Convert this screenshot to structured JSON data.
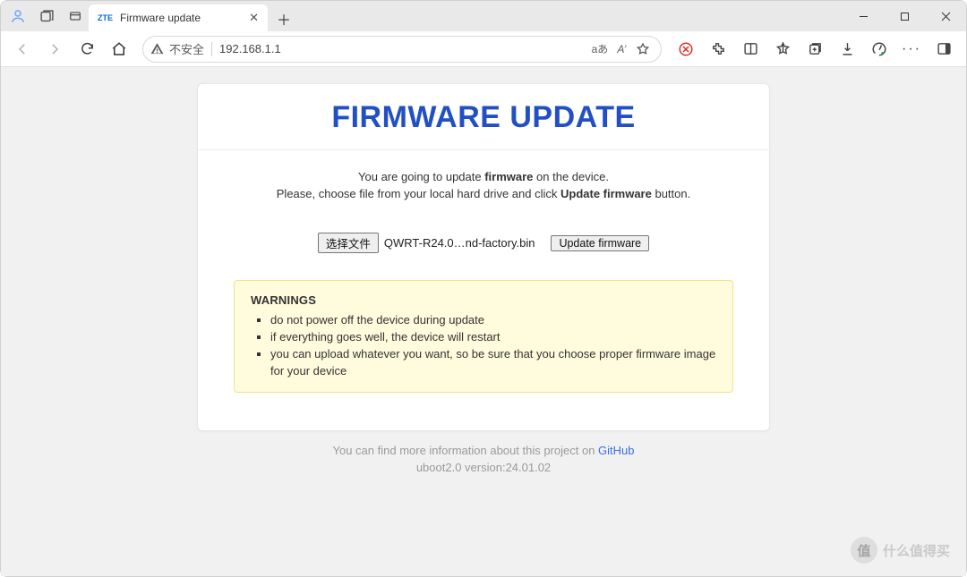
{
  "window": {
    "tab_favicon_text": "ZTE",
    "tab_title": "Firmware update"
  },
  "toolbar": {
    "insecure_label": "不安全",
    "url": "192.168.1.1",
    "reader_label": "aあ"
  },
  "page": {
    "heading": "FIRMWARE UPDATE",
    "line1_pre": "You are going to update ",
    "line1_bold": "firmware",
    "line1_post": " on the device.",
    "line2_pre": "Please, choose file from your local hard drive and click ",
    "line2_bold": "Update firmware",
    "line2_post": " button.",
    "choose_file_label": "选择文件",
    "chosen_filename": "QWRT-R24.0…nd-factory.bin",
    "update_button_label": "Update firmware",
    "warnings_title": "WARNINGS",
    "warnings": [
      "do not power off the device during update",
      "if everything goes well, the device will restart",
      "you can upload whatever you want, so be sure that you choose proper firmware image for your device"
    ],
    "footer_pre": "You can find more information about this project on ",
    "footer_link": "GitHub",
    "footer_version": "uboot2.0 version:24.01.02"
  },
  "watermark": {
    "badge": "值",
    "text": "什么值得买"
  }
}
